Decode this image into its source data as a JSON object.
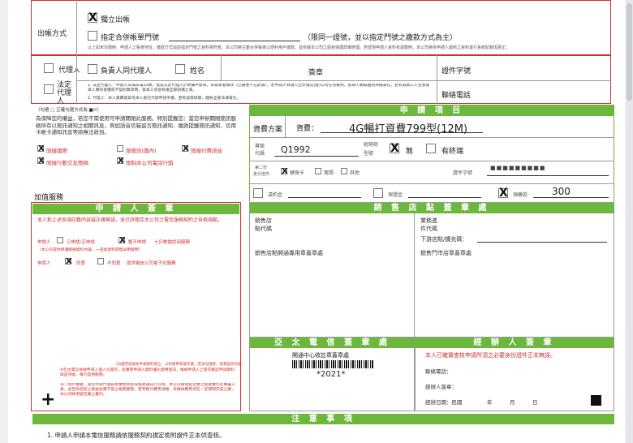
{
  "billing": {
    "label": "出帳方式",
    "opt1": "獨立出帳",
    "opt2": "指定合併帳單門號",
    "opt2_note": "（限同一證號，並以指定門號之繳款方式為主）",
    "fine_print": "以上如未勾選時，申請人之帳單地址，繳款方式與該指定門號之資料相符者，本公司將主動合併帳單以便利用戶繳款，並依據本公司之個資保護政策辦理。若發現申請人資料有異動時，本公司將依申請人最新之資料進行系統紀錄與更正。"
  },
  "agent": {
    "label": "代理人",
    "opt_same": "負責人同代理人",
    "name_label": "姓名",
    "sign_label": "簽章",
    "id_label": "證件字號",
    "legal_label": "法定代理人",
    "phone_label": "聯絡電話",
    "note1": "1. 法定代理人：申請人未滿未滿20歲，需其法定代理人於本欄中簽章，未簽章者無效（已婚者不在此限）。若申請人有積欠亞太電信(股)公司任何費用，簽章人願與連帶清償責任，若有與第三人主張簽章人應同意權或不契約無效時，簽章人同意負擔全部賠償之責。",
    "note2": "2. 代理人：本人資費簽章為本人委託代辦申請手續，若有虛偽情節，願負全部法律責任。"
  },
  "privacy": {
    "header": "（勾選 □ 正確勾選方式為 ■☑）",
    "body": "為保障您的權益，若您不需使用可申請關閉此服務。特別提醒您：當您申辦關閉簡訊服務所有以簡訊通知之相關訊息，例如語音信箱留言簡訊通知、繳款提醒簡訊通知、信用卡帳卡通知訊息等將無法收到。",
    "opt1": "限撥國際",
    "opt2": "限簡訊(國內)",
    "opt3": "限撥付費語音",
    "opt4": "限撥行動交友簡碼",
    "opt5": "限制本公司電話行銷",
    "addon": "加值服務"
  },
  "applicant": {
    "header": "申 請 人 簽 章",
    "intro": "本人對上述各項記載內容誠正確無誤，並已詳閱亞太公司之電信服務契約之各條規範。",
    "line1_a": "申請人",
    "line1_b": "已申請/正申請",
    "line1_c": "暫不申請",
    "line1_d": "七日數據試用服務",
    "line1_note": "（本公司提供保護帳號資料內容，一週後資料即無試用服務）",
    "line2_a": "申請人",
    "line2_b": "同意",
    "line2_c": "不同意",
    "line2_d": "提供電信公司電子化服務",
    "notes_small": "（勾選完成後依申請資料建立，以利帳單寄發作業。若未勾選者，則預設為同意）",
    "notes_red1": "※亞太電信依據申請人個人化需求，及實際申請人資料優化使用資訊，根據申請人之需求確認申請資料與品項後，再行提供服務。",
    "notes_red2": "為了用戶權益，當您申辦門號與本業務用量或帳款通知行為時，本公司將保留您業之帳號權利及專屬人員，並告知您您之帳號並遭不當之帳務服務，若有暫付費用須繳、未繳納費用須在一定期間完成之繳，本公司將保留您業之權利。"
  },
  "application": {
    "header": "申 請 項 目",
    "plan_label": "資費方案",
    "fee_label": "資費：",
    "fee_value": "4G暢打資費799型(12M)",
    "project_label1": "專案",
    "project_label2": "代碼",
    "project_code": "Q1992",
    "dealer_label1": "經銷商",
    "dealer_label2": "型號",
    "none_label": "無",
    "has_device": "有終端",
    "second_id1": "第二份",
    "second_id2": "身分證件",
    "health": "健保卡",
    "license": "駕照",
    "other": "其他",
    "id_no_label": "證件字號",
    "id_masked": "■■■■■■■■■",
    "deposit": "違約金",
    "guarantee": "保證金",
    "prepaid": "預繳款",
    "prepaid_value": "300"
  },
  "store": {
    "header": "銷 售 店 點 蓋 章 處",
    "sales_store": "銷售店",
    "store_code": "點代碼",
    "business": "業務進",
    "item_code": "件代碼",
    "branch": "下游店點/擴充碼：",
    "stamp_left": "銷售店點開通專用章蓋章處",
    "stamp_right": "銷售門市店章蓋章處"
  },
  "telecom": {
    "header": "亞 太 電 信 蓋 章 處",
    "center": "開通中心收訖章蓋章處",
    "barcode_text": "*2021*"
  },
  "handler": {
    "header": "經 辦 人 簽 章",
    "statement": "本人已確實查核申請所須之必要身份證件正本無誤。",
    "phone": "聯絡電話：",
    "signer": "經辦人簽章：",
    "date": "經辦日期：民國",
    "year": "年",
    "month": "月",
    "day": "日"
  },
  "notice": {
    "header": "注 意 事 項",
    "item1": "1. 申請人申請本電信服務請依服務契約規定檢附證件正本供查核。"
  },
  "marks": {
    "x": "X"
  }
}
